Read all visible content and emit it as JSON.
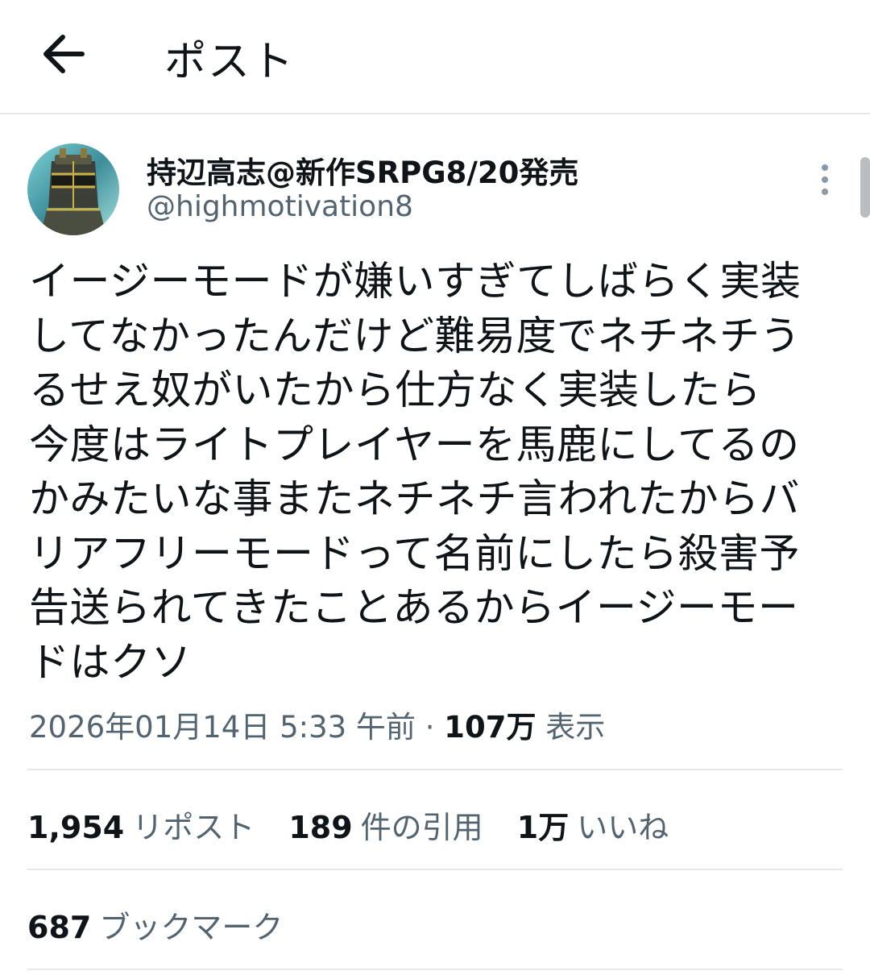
{
  "header": {
    "title": "ポスト",
    "back_icon": "arrow-left-icon"
  },
  "author": {
    "name": "持辺高志@新作SRPG8/20発売",
    "handle": "@highmotivation8"
  },
  "post": {
    "text": "イージーモードが嫌いすぎてしばらく実装\nしてなかったんだけど難易度でネチネチう\nるせえ奴がいたから仕方なく実装したら\n今度はライトプレイヤーを馬鹿にしてるの\nかみたいな事またネチネチ言われたからバ\nリアフリーモードって名前にしたら殺害予\n告送られてきたことあるからイージーモー\nドはクソ",
    "timestamp": "2026年01月14日 5:33 午前",
    "separator": " · ",
    "views_count": "107万",
    "views_label": "表示"
  },
  "stats": {
    "reposts_count": "1,954",
    "reposts_label": "リポスト",
    "quotes_count": "189",
    "quotes_label": "件の引用",
    "likes_count": "1万",
    "likes_label": "いいね",
    "bookmarks_count": "687",
    "bookmarks_label": "ブックマーク"
  },
  "colors": {
    "text": "#0f1419",
    "secondary": "#536471",
    "divider": "#e6e9ec"
  }
}
